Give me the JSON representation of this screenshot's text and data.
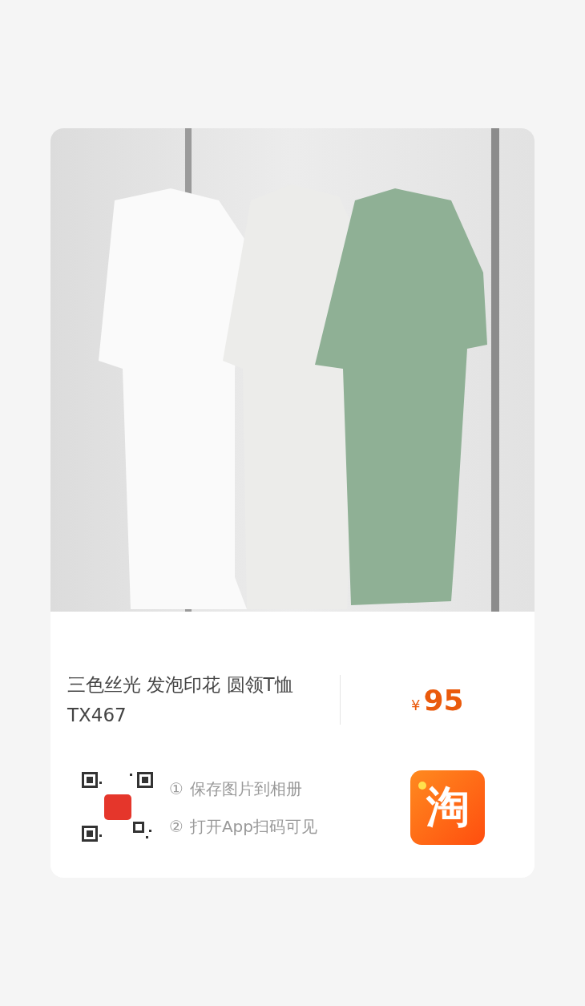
{
  "product": {
    "title": "三色丝光 发泡印花 圆领T恤 TX467",
    "currency": "¥",
    "price": "95"
  },
  "steps": [
    {
      "number": "①",
      "text": "保存图片到相册"
    },
    {
      "number": "②",
      "text": "打开App扫码可见"
    }
  ],
  "app_logo": {
    "text": "淘"
  }
}
